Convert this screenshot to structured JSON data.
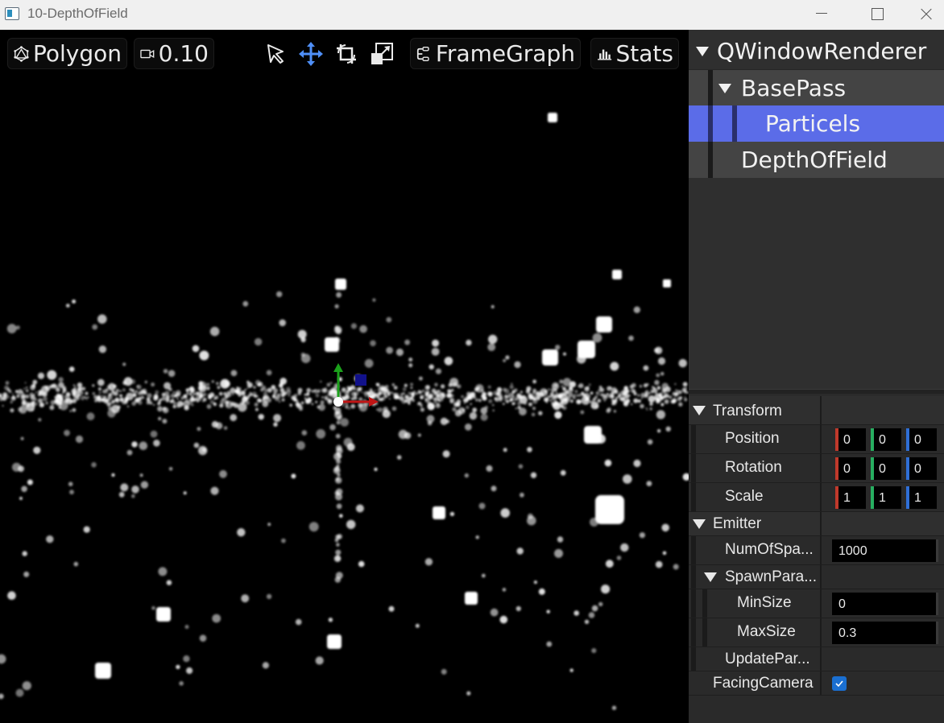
{
  "window": {
    "title": "10-DepthOfField",
    "minimize_icon": "minimize-icon",
    "maximize_icon": "maximize-icon",
    "close_icon": "close-icon"
  },
  "toolbar": {
    "polygon_label": "Polygon",
    "camera_value": "0.10",
    "framegraph_label": "FrameGraph",
    "stats_label": "Stats",
    "active_tool": "move"
  },
  "tree": {
    "items": [
      {
        "label": "QWindowRenderer",
        "expanded": true,
        "depth": 0
      },
      {
        "label": "BasePass",
        "expanded": true,
        "depth": 1
      },
      {
        "label": "Particels",
        "selected": true,
        "depth": 2
      },
      {
        "label": "DepthOfField",
        "depth": 1
      }
    ]
  },
  "properties": {
    "transform": {
      "label": "Transform",
      "position": {
        "label": "Position",
        "x": "0",
        "y": "0",
        "z": "0"
      },
      "rotation": {
        "label": "Rotation",
        "x": "0",
        "y": "0",
        "z": "0"
      },
      "scale": {
        "label": "Scale",
        "x": "1",
        "y": "1",
        "z": "1"
      }
    },
    "emitter": {
      "label": "Emitter",
      "num_of_spawn": {
        "label": "NumOfSpa...",
        "value": "1000"
      },
      "spawn_params": {
        "label": "SpawnPara...",
        "min_size": {
          "label": "MinSize",
          "value": "0"
        },
        "max_size": {
          "label": "MaxSize",
          "value": "0.3"
        }
      },
      "update_params": {
        "label": "UpdatePar..."
      }
    },
    "facing_camera": {
      "label": "FacingCamera",
      "checked": true
    }
  },
  "colors": {
    "selection": "#5b6ce8",
    "axis_x": "#c0392b",
    "axis_y": "#27ae60",
    "axis_z": "#2f6fd6",
    "checkbox": "#1a6fd1"
  }
}
